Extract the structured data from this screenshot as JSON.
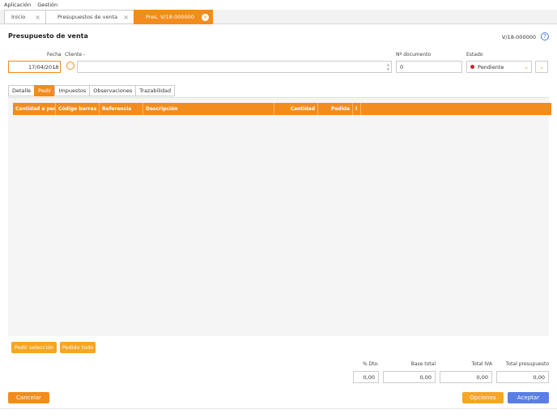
{
  "menu": {
    "app": "Aplicación",
    "gestion": "Gestión"
  },
  "tabs": [
    {
      "label": "Inicio"
    },
    {
      "label": "Presupuestos de venta"
    },
    {
      "label": "Pres. V/18-000000"
    }
  ],
  "doc": {
    "title": "Presupuesto de venta",
    "number": "V/18-000000"
  },
  "form": {
    "fecha_label": "Fecha",
    "fecha_value": "17/04/2018",
    "cliente_label": "Cliente  -",
    "ndoc_label": "Nº documento",
    "ndoc_value": "0",
    "estado_label": "Estado",
    "estado_value": "Pendiente"
  },
  "subtabs": [
    "Detalle",
    "Pedir",
    "Impuestos",
    "Observaciones",
    "Trazabilidad"
  ],
  "grid": {
    "columns": [
      "Cantidad a pedir",
      "Código barras",
      "Referencia",
      "Descripción",
      "Cantidad",
      "Pedida",
      "I"
    ]
  },
  "actions": {
    "pedir_seleccion": "Pedir selección",
    "pedido_todo": "Pedido todo"
  },
  "totals": {
    "dto_label": "% Dto.",
    "base_label": "Base total",
    "iva_label": "Total IVA",
    "total_label": "Total presupuesto",
    "dto_value": "0,00",
    "base_value": "0,00",
    "iva_value": "0,00",
    "total_value": "0,00"
  },
  "footer": {
    "cancel": "Cancelar",
    "options": "Opciones",
    "accept": "Aceptar"
  },
  "colors": {
    "accent": "#f28c1c",
    "accent_light": "#f5a623",
    "accept": "#5a7de6",
    "status_red": "#c0282e"
  }
}
